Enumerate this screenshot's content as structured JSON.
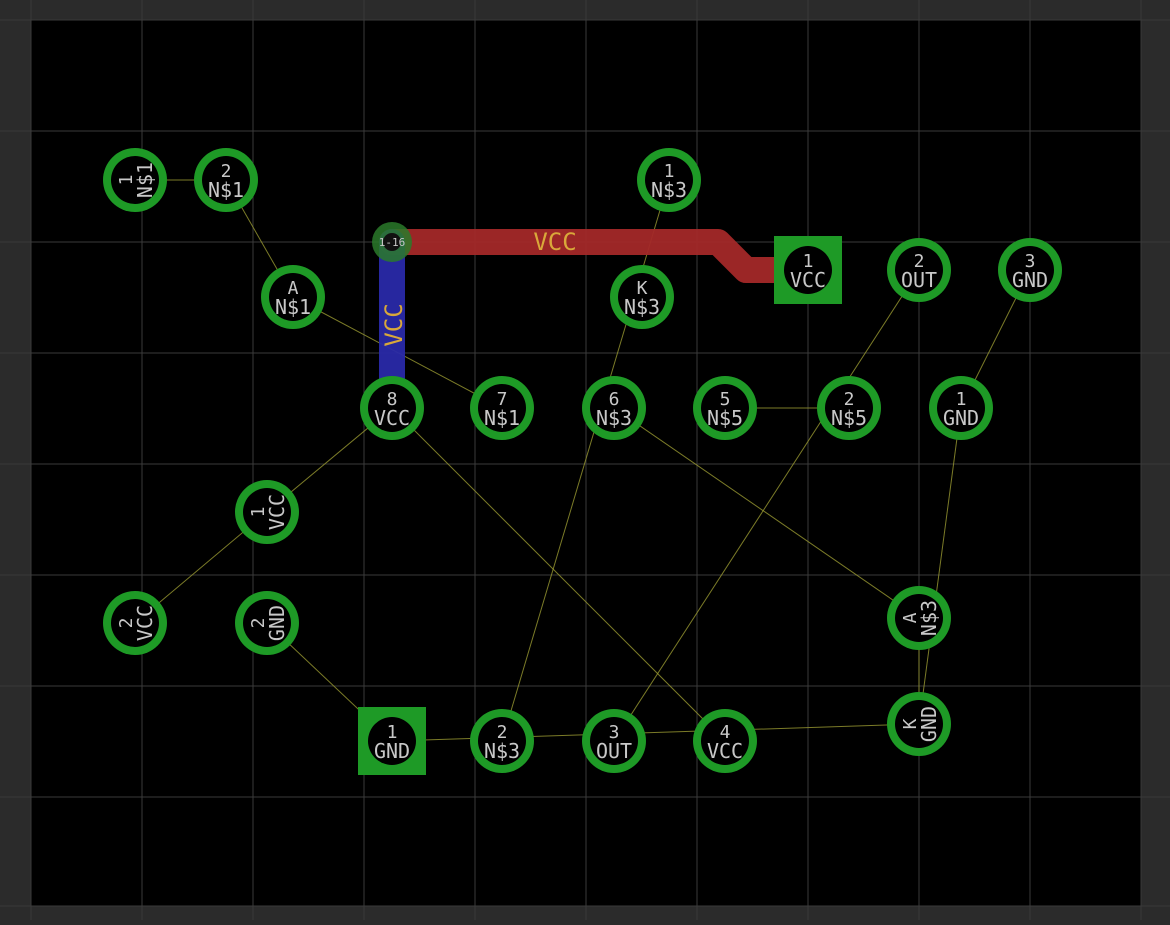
{
  "colors": {
    "background": "#2b2b2b",
    "board": "#000000",
    "board_outline": "#c8a060",
    "grid": "#3a3a3a",
    "pad": "#1e9a26",
    "pad_drill": "#000000",
    "pad_text": "#c8c8c8",
    "ratsnest": "#9a9a32",
    "top_copper": "#a32828",
    "bottom_copper": "#2a2aa8",
    "net_label": "#d9a83a",
    "via": "#2a7a2a"
  },
  "via": {
    "label": "1-16"
  },
  "traces": [
    {
      "layer": "top",
      "net": "VCC",
      "label": "VCC"
    },
    {
      "layer": "bottom",
      "net": "VCC",
      "label": "VCC"
    }
  ],
  "pads": [
    {
      "num": "1",
      "net": "N$1",
      "shape": "round",
      "rotated": true
    },
    {
      "num": "2",
      "net": "N$1",
      "shape": "round",
      "rotated": false
    },
    {
      "num": "A",
      "net": "N$1",
      "shape": "round",
      "rotated": false
    },
    {
      "num": "1",
      "net": "N$3",
      "shape": "round",
      "rotated": false
    },
    {
      "num": "K",
      "net": "N$3",
      "shape": "round",
      "rotated": false
    },
    {
      "num": "1",
      "net": "VCC",
      "shape": "square",
      "rotated": false
    },
    {
      "num": "2",
      "net": "OUT",
      "shape": "round",
      "rotated": false
    },
    {
      "num": "3",
      "net": "GND",
      "shape": "round",
      "rotated": false
    },
    {
      "num": "8",
      "net": "VCC",
      "shape": "round",
      "rotated": false
    },
    {
      "num": "7",
      "net": "N$1",
      "shape": "round",
      "rotated": false
    },
    {
      "num": "6",
      "net": "N$3",
      "shape": "round",
      "rotated": false
    },
    {
      "num": "5",
      "net": "N$5",
      "shape": "round",
      "rotated": false
    },
    {
      "num": "2",
      "net": "N$5",
      "shape": "round",
      "rotated": false
    },
    {
      "num": "1",
      "net": "GND",
      "shape": "round",
      "rotated": false
    },
    {
      "num": "1",
      "net": "VCC",
      "shape": "round",
      "rotated": true
    },
    {
      "num": "2",
      "net": "VCC",
      "shape": "round",
      "rotated": true
    },
    {
      "num": "2",
      "net": "GND",
      "shape": "round",
      "rotated": true
    },
    {
      "num": "A",
      "net": "N$3",
      "shape": "round",
      "rotated": true
    },
    {
      "num": "1",
      "net": "GND",
      "shape": "square",
      "rotated": false
    },
    {
      "num": "2",
      "net": "N$3",
      "shape": "round",
      "rotated": false
    },
    {
      "num": "3",
      "net": "OUT",
      "shape": "round",
      "rotated": false
    },
    {
      "num": "4",
      "net": "VCC",
      "shape": "round",
      "rotated": false
    },
    {
      "num": "K",
      "net": "GND",
      "shape": "round",
      "rotated": true
    }
  ]
}
